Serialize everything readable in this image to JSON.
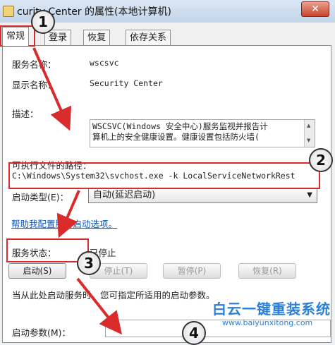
{
  "window": {
    "title": "curity Center 的属性(本地计算机)",
    "close_symbol": "✕"
  },
  "tabs": [
    {
      "label": "常规"
    },
    {
      "label": "登录"
    },
    {
      "label": "恢复"
    },
    {
      "label": "依存关系"
    }
  ],
  "general": {
    "service_name_label": "服务名称：",
    "service_name": "wscsvc",
    "display_name_label": "显示名称：",
    "display_name": "Security Center",
    "description_label": "描述：",
    "description_line1": "WSCSVC(Windows 安全中心)服务监视并报告计",
    "description_line2": "算机上的安全健康设置。健康设置包括防火墙(",
    "exe_path_label": "可执行文件的路径：",
    "exe_path": "C:\\Windows\\System32\\svchost.exe -k LocalServiceNetworkRest",
    "startup_type_label": "启动类型(E)：",
    "startup_type_value": "自动(延迟启动)",
    "help_link": "帮助我配置服务启动选项。",
    "status_label": "服务状态：",
    "status_value": "已停止",
    "buttons": {
      "start": "启动(S)",
      "stop": "停止(T)",
      "pause": "暂停(P)",
      "resume": "恢复(R)"
    },
    "start_hint": "当从此处启动服务时，您可指定所适用的启动参数。",
    "params_label": "启动参数(M)："
  },
  "annotations": {
    "marker_1": "1",
    "marker_2": "2",
    "marker_3": "3",
    "marker_4": "4",
    "highlight_color": "#d92b2b"
  },
  "watermark": {
    "title": "白云一键重装系统",
    "url": "www.baiyunxitong.com"
  }
}
